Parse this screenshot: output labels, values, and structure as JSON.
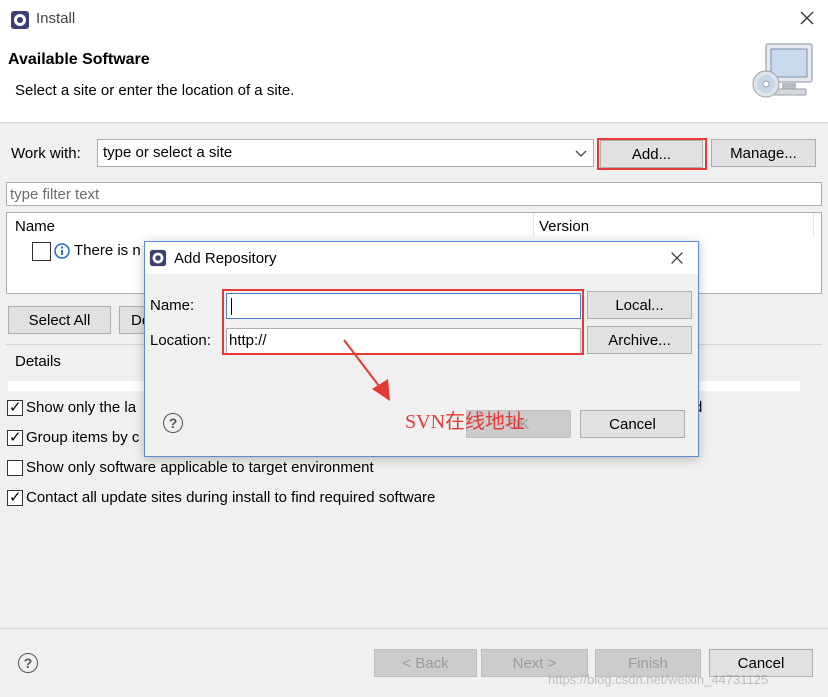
{
  "window": {
    "title": "Install"
  },
  "header": {
    "title": "Available Software",
    "subtitle": "Select a site or enter the location of a site."
  },
  "work_with": {
    "label": "Work with:",
    "value": "type or select a site",
    "add_label": "Add...",
    "manage_label": "Manage..."
  },
  "filter": {
    "placeholder": "type filter text"
  },
  "table": {
    "columns": [
      "Name",
      "Version"
    ],
    "rows": [
      {
        "name": "There is n"
      }
    ]
  },
  "buttons": {
    "select_all": "Select All",
    "deselect_all": "De"
  },
  "details": {
    "label": "Details"
  },
  "options": [
    {
      "label": "Show only the la",
      "checked": true
    },
    {
      "label": "Group items by c",
      "checked": true
    },
    {
      "label": "Show only software applicable to target environment",
      "checked": false
    },
    {
      "label": "Contact all update sites during install to find required software",
      "checked": true
    }
  ],
  "options_tail": "d",
  "dialog": {
    "title": "Add Repository",
    "name_label": "Name:",
    "name_value": "",
    "location_label": "Location:",
    "location_value": "http://",
    "local_label": "Local...",
    "archive_label": "Archive...",
    "ok_label": "OK",
    "cancel_label": "Cancel"
  },
  "annotation": {
    "text": "SVN在线地址",
    "color": "#e53935"
  },
  "footer": {
    "back_label": "< Back",
    "next_label": "Next >",
    "finish_label": "Finish",
    "cancel_label": "Cancel"
  },
  "watermark": "https://blog.csdn.net/weixin_44731125"
}
